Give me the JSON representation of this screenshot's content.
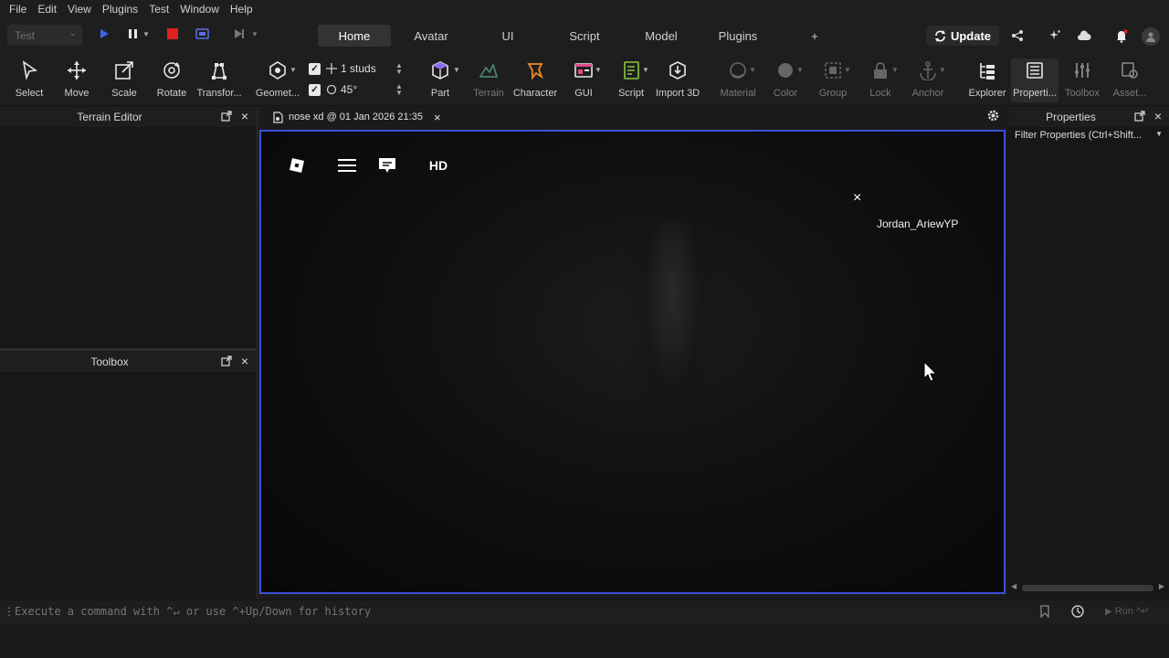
{
  "menu": [
    "File",
    "Edit",
    "View",
    "Plugins",
    "Test",
    "Window",
    "Help"
  ],
  "test_select": "Test",
  "tabs": [
    {
      "label": "Home",
      "active": true
    },
    {
      "label": "Avatar"
    },
    {
      "label": "UI"
    },
    {
      "label": "Script"
    },
    {
      "label": "Model"
    },
    {
      "label": "Plugins"
    },
    {
      "label": "+"
    }
  ],
  "update_label": "Update",
  "ribbon": {
    "select": "Select",
    "move": "Move",
    "scale": "Scale",
    "rotate": "Rotate",
    "transform": "Transfor...",
    "geometry": "Geomet...",
    "snap_move": "1 studs",
    "snap_rotate": "45°",
    "part": "Part",
    "terrain": "Terrain",
    "character": "Character",
    "gui": "GUI",
    "script": "Script",
    "import3d": "Import 3D",
    "material": "Material",
    "color": "Color",
    "group": "Group",
    "lock": "Lock",
    "anchor": "Anchor",
    "explorer": "Explorer",
    "properties": "Properti...",
    "toolbox": "Toolbox",
    "assets": "Asset..."
  },
  "panels": {
    "terrain_editor": "Terrain Editor",
    "toolbox": "Toolbox",
    "properties": "Properties",
    "filter_placeholder": "Filter Properties (Ctrl+Shift..."
  },
  "doc_tab": "nose xd @ 01 Jan 2026 21:35",
  "viewport": {
    "hd_label": "HD",
    "player_name": "Jordan_AriewYP"
  },
  "command": {
    "placeholder": "Execute a command with ^↵ or use ^+Up/Down for history",
    "run": "Run ^↵"
  },
  "colors": {
    "accent": "#3d4fd6",
    "part_purple": "#8a6cf0",
    "character_orange": "#f08a2a",
    "gui_pink": "#e04a8a",
    "script_green": "#8cc63f",
    "stop_red": "#e02020",
    "play_blue": "#3a66e8"
  }
}
